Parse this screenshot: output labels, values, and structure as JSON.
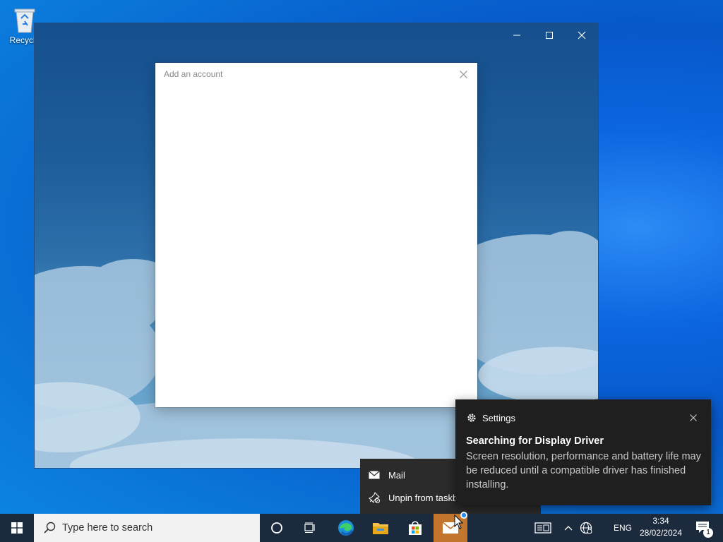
{
  "desktop": {
    "recycle_bin_label": "Recycle"
  },
  "window": {
    "controls": [
      "minimize-icon",
      "maximize-icon",
      "close-icon"
    ]
  },
  "dialog": {
    "title": "Add an account"
  },
  "jumplist": {
    "items": [
      {
        "label": "Mail",
        "icon": "mail-icon"
      },
      {
        "label": "Unpin from taskba",
        "icon": "unpin-icon"
      }
    ]
  },
  "toast": {
    "app_name": "Settings",
    "heading": "Searching for Display Driver",
    "body": "Screen resolution, performance and battery life may be reduced until a compatible driver has finished installing."
  },
  "taskbar": {
    "search_placeholder": "Type here to search",
    "language": "ENG",
    "time": "3:34",
    "date": "28/02/2024",
    "notification_count": "1",
    "accent": "#c2762d"
  }
}
